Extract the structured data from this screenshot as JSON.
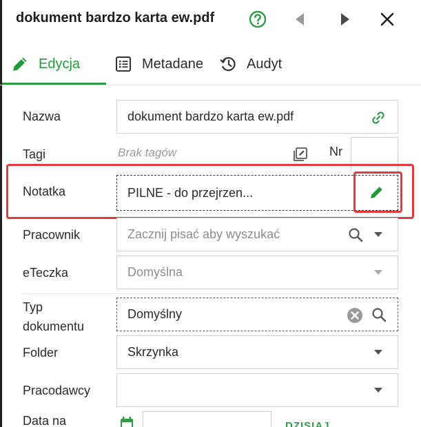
{
  "header": {
    "title": "dokument bardzo karta ew.pdf"
  },
  "tabs": [
    {
      "label": "Edycja",
      "icon": "pencil-icon",
      "active": true
    },
    {
      "label": "Metadane",
      "icon": "list-icon",
      "active": false
    },
    {
      "label": "Audyt",
      "icon": "history-icon",
      "active": false
    }
  ],
  "form": {
    "name": {
      "label": "Nazwa",
      "value": "dokument bardzo karta ew.pdf"
    },
    "tags": {
      "label": "Tagi",
      "empty_text": "Brak tagów",
      "nr_label": "Nr"
    },
    "note": {
      "label": "Notatka",
      "value": "PILNE - do przejrzen..."
    },
    "employee": {
      "label": "Pracownik",
      "placeholder": "Zacznij pisać aby wyszukać"
    },
    "efolder": {
      "label": "eTeczka",
      "value": "Domyślna"
    },
    "doc_type": {
      "label_line1": "Typ",
      "label_line2": "dokumentu",
      "value": "Domyślny"
    },
    "folder": {
      "label": "Folder",
      "value": "Skrzynka"
    },
    "employers": {
      "label": "Pracodawcy",
      "value": ""
    },
    "date": {
      "label": "Data na",
      "today_label": "DZISIAJ"
    }
  },
  "colors": {
    "accent": "#2e9c47",
    "highlight": "#e03a3e",
    "text": "#212121",
    "placeholder": "#8c8c8c"
  }
}
